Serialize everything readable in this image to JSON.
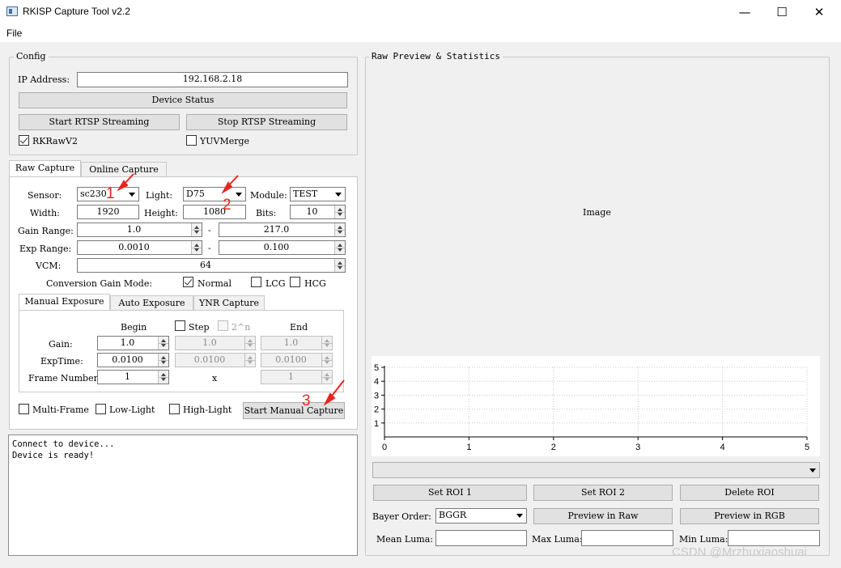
{
  "window": {
    "title": "RKISP Capture Tool v2.2",
    "minimize": "—",
    "maximize": "☐",
    "close": "✕"
  },
  "menu": {
    "file": "File"
  },
  "config": {
    "title": "Config",
    "ip_label": "IP Address:",
    "ip_value": "192.168.2.18",
    "device_status": "Device Status",
    "start_rtsp": "Start RTSP Streaming",
    "stop_rtsp": "Stop RTSP Streaming",
    "rkrawv2": {
      "label": "RKRawV2",
      "checked": true
    },
    "yuvmerge": {
      "label": "YUVMerge",
      "checked": false
    }
  },
  "tabs": {
    "raw_capture": "Raw Capture",
    "online_capture": "Online Capture"
  },
  "raw": {
    "sensor_label": "Sensor:",
    "sensor_value": "sc230",
    "light_label": "Light:",
    "light_value": "D75",
    "module_label": "Module:",
    "module_value": "TEST",
    "width_label": "Width:",
    "width_value": "1920",
    "height_label": "Height:",
    "height_value": "1080",
    "bits_label": "Bits:",
    "bits_value": "10",
    "gain_range_label": "Gain Range:",
    "gain_min": "1.0",
    "gain_max": "217.0",
    "exp_range_label": "Exp Range:",
    "exp_min": "0.0010",
    "exp_max": "0.100",
    "dash": "-",
    "vcm_label": "VCM:",
    "vcm_value": "64",
    "cgm_label": "Conversion Gain Mode:",
    "cgm_normal": "Normal",
    "cgm_lcg": "LCG",
    "cgm_hcg": "HCG"
  },
  "subtabs": {
    "manual": "Manual Exposure",
    "auto": "Auto Exposure",
    "ynr": "YNR Capture"
  },
  "manual": {
    "begin": "Begin",
    "step": "Step",
    "pow": "2^n",
    "end": "End",
    "gain_label": "Gain:",
    "gain_begin": "1.0",
    "gain_step": "1.0",
    "gain_end": "1.0",
    "exptime_label": "ExpTime:",
    "exp_begin": "0.0100",
    "exp_step": "0.0100",
    "exp_end": "0.0100",
    "frame_label": "Frame Number:",
    "frame_begin": "1",
    "x": "x",
    "frame_end": "1"
  },
  "options": {
    "multi_frame": "Multi-Frame",
    "low_light": "Low-Light",
    "high_light": "High-Light",
    "start_capture": "Start Manual Capture"
  },
  "log": {
    "line1": "Connect to device...",
    "line2": "Device is ready!"
  },
  "preview": {
    "title": "Raw Preview & Statistics",
    "image_label": "Image",
    "set_roi1": "Set ROI 1",
    "set_roi2": "Set ROI 2",
    "delete_roi": "Delete ROI",
    "bayer_label": "Bayer Order:",
    "bayer_value": "BGGR",
    "preview_raw": "Preview in Raw",
    "preview_rgb": "Preview in RGB",
    "mean_luma": "Mean Luma:",
    "max_luma": "Max Luma:",
    "min_luma": "Min Luma:"
  },
  "annotations": {
    "a1": "1",
    "a2": "2",
    "a3": "3",
    "color": "#e8261c"
  },
  "watermark": "CSDN @Mrzhuxiaoshuai",
  "chart_data": {
    "type": "line",
    "x_ticks": [
      "0",
      "1",
      "2",
      "3",
      "4",
      "5"
    ],
    "y_ticks": [
      "1",
      "2",
      "3",
      "4",
      "5"
    ],
    "xlim": [
      0,
      5
    ],
    "ylim": [
      0,
      5
    ],
    "grid": true,
    "series": []
  }
}
